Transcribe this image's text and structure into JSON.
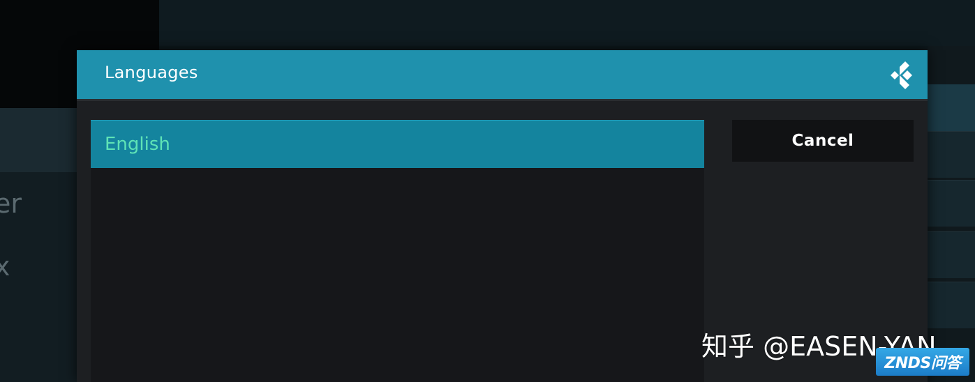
{
  "dialog": {
    "title": "Languages",
    "logo_icon": "kodi-logo-icon",
    "items": [
      {
        "label": "English",
        "selected": true
      }
    ],
    "cancel_label": "Cancel"
  },
  "background": {
    "partial_text_1": "er",
    "partial_text_2": "x"
  },
  "watermarks": {
    "zhihu": "知乎 @EASEN-YAN",
    "znds": "ZNDS问答"
  },
  "colors": {
    "header": "#1f91ad",
    "selected_item": "#14849e",
    "selected_text": "#5fe3b6",
    "dialog_bg": "#1d1f22"
  }
}
